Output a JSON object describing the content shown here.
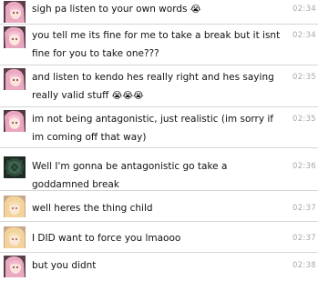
{
  "messages": [
    {
      "text": "sigh pa listen to your own words",
      "emoji": "😭",
      "time": "02:34",
      "avatar": "anime-girl-pink"
    },
    {
      "text": "you tell me its fine for me to take a break but it isnt fine for you to take one???",
      "emoji": "",
      "time": "02:34",
      "avatar": "anime-girl-pink"
    },
    {
      "text": "and listen to kendo hes really right and hes saying really valid stuff",
      "emoji": "😭😭😭",
      "time": "02:35",
      "avatar": "anime-girl-pink"
    },
    {
      "text": "im not being antagonistic, just realistic (im sorry if im coming off that way)",
      "emoji": "",
      "time": "02:35",
      "avatar": "anime-girl-pink"
    },
    {
      "text": "Well I'm gonna be antagonistic go take a goddamned break",
      "emoji": "",
      "time": "02:36",
      "avatar": "dark-green-avatar"
    },
    {
      "text": "well heres the thing child",
      "emoji": "",
      "time": "02:37",
      "avatar": "anime-girl-blonde"
    },
    {
      "text": "I DID want to force you lmaooo",
      "emoji": "",
      "time": "02:37",
      "avatar": "anime-girl-blonde"
    },
    {
      "text": "but you didnt",
      "emoji": "",
      "time": "02:38",
      "avatar": "anime-girl-pink"
    }
  ],
  "colors": {
    "separator": "#d6d6d6",
    "timestamp": "#a8a8a8",
    "text": "#111111"
  }
}
